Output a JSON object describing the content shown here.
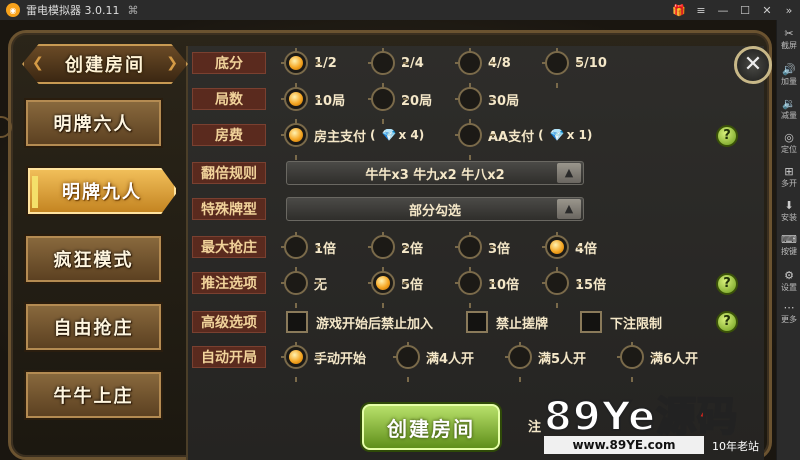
{
  "titlebar": {
    "app_title": "雷电模拟器 3.0.11",
    "logo_glyph": "◉",
    "gamepad_icon": "gamepad-icon",
    "controls": [
      "🎁",
      "≡",
      "—",
      "☐",
      "✕",
      "»"
    ]
  },
  "sidebar": {
    "items": [
      {
        "icon": "✂",
        "label": "截屏"
      },
      {
        "icon": "🔊",
        "label": "加量"
      },
      {
        "icon": "🔉",
        "label": "减量"
      },
      {
        "icon": "◎",
        "label": "定位"
      },
      {
        "icon": "⊞",
        "label": "多开"
      },
      {
        "icon": "⬇",
        "label": "安装"
      },
      {
        "icon": "⌨",
        "label": "按键"
      },
      {
        "icon": "⚙",
        "label": "设置"
      },
      {
        "icon": "⋯",
        "label": "更多"
      }
    ]
  },
  "header": {
    "title": "创建房间",
    "close_glyph": "✕"
  },
  "modes": [
    {
      "label": "明牌六人",
      "active": false
    },
    {
      "label": "明牌九人",
      "active": true
    },
    {
      "label": "疯狂模式",
      "active": false
    },
    {
      "label": "自由抢庄",
      "active": false
    },
    {
      "label": "牛牛上庄",
      "active": false
    }
  ],
  "options": {
    "difen": {
      "label": "底分",
      "choices": [
        "1/2",
        "2/4",
        "4/8",
        "5/10"
      ],
      "selected": 0
    },
    "jushu": {
      "label": "局数",
      "choices": [
        "10局",
        "20局",
        "30局"
      ],
      "selected": 0
    },
    "fangfei": {
      "label": "房费",
      "choices": [
        {
          "text": "房主支付",
          "cost": "x 4"
        },
        {
          "text": "AA支付",
          "cost": "x 1"
        }
      ],
      "selected": 0,
      "paren_open": "(",
      "paren_close": ")"
    },
    "fanbei": {
      "label": "翻倍规则",
      "value": "牛牛x3  牛九x2  牛八x2"
    },
    "teshu": {
      "label": "特殊牌型",
      "value": "部分勾选"
    },
    "qiangzhuang": {
      "label": "最大抢庄",
      "choices": [
        "1倍",
        "2倍",
        "3倍",
        "4倍"
      ],
      "selected": 3
    },
    "tuizhu": {
      "label": "推注选项",
      "choices": [
        "无",
        "5倍",
        "10倍",
        "15倍"
      ],
      "selected": 1
    },
    "gaoji": {
      "label": "高级选项",
      "checks": [
        "游戏开始后禁止加入",
        "禁止搓牌",
        "下注限制"
      ]
    },
    "zidong": {
      "label": "自动开局",
      "choices": [
        "手动开始",
        "满4人开",
        "满5人开",
        "满6人开"
      ],
      "selected": 0
    }
  },
  "help_glyph": "?",
  "create_button": "创建房间",
  "note_text": "注",
  "watermark": {
    "main_a": "89Ye",
    "main_b": "源码",
    "url": "www.89YE.com",
    "tag": "10年老站"
  },
  "colors": {
    "accent_gold": "#f5a623",
    "label_bg": "#5a2a1e",
    "create_green": "#7fb02a"
  }
}
